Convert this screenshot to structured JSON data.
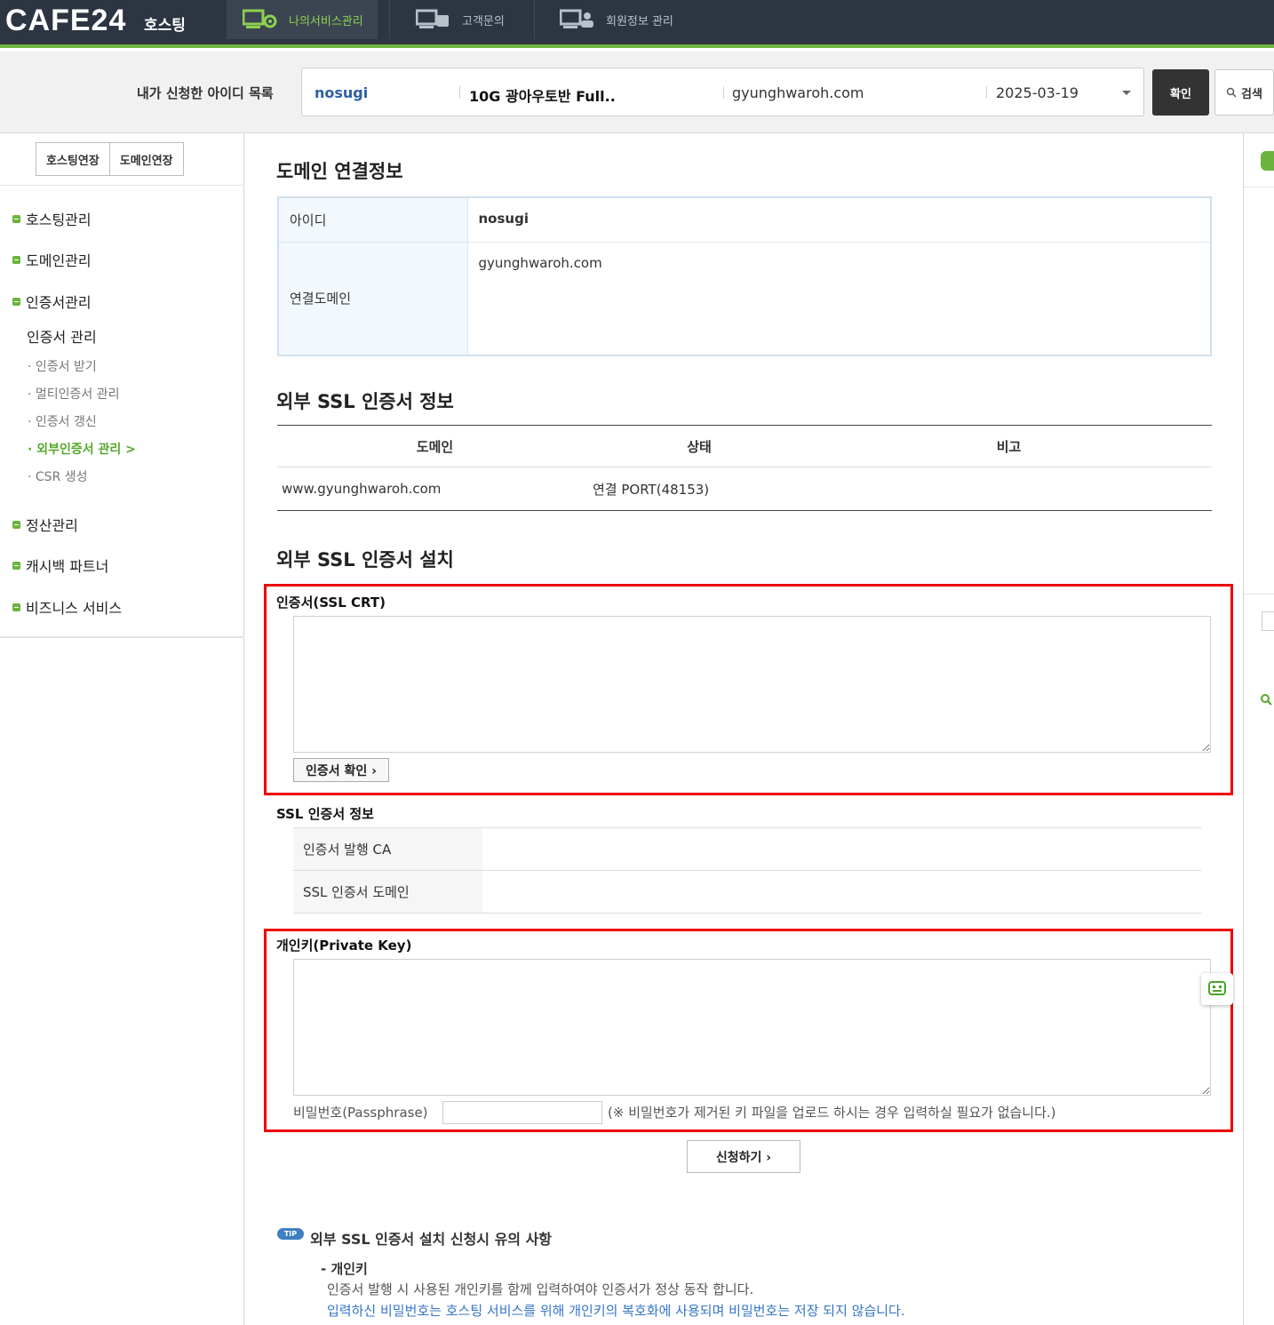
{
  "header": {
    "logo": "CAFE24",
    "logo_sub": "호스팅",
    "tabs": [
      {
        "label": "나의서비스관리"
      },
      {
        "label": "고객문의"
      },
      {
        "label": "회원정보 관리"
      }
    ]
  },
  "idbar": {
    "label": "내가 신청한 아이디 목록",
    "selected": {
      "id": "nosugi",
      "product": "10G 광아우토반 Full..",
      "domain": "gyunghwaroh.com",
      "date": "2025-03-19"
    },
    "confirm": "확인",
    "search": "검색"
  },
  "sidebar": {
    "extend_hosting": "호스팅연장",
    "extend_domain": "도메인연장",
    "menu": [
      {
        "label": "호스팅관리"
      },
      {
        "label": "도메인관리"
      },
      {
        "label": "인증서관리"
      },
      {
        "label": "정산관리"
      },
      {
        "label": "캐시백 파트너"
      },
      {
        "label": "비즈니스 서비스"
      }
    ],
    "sub_title": "인증서 관리",
    "sub_items": [
      {
        "label": "인증서 받기"
      },
      {
        "label": "멀티인증서 관리"
      },
      {
        "label": "인증서 갱신"
      },
      {
        "label": "외부인증서 관리 >"
      },
      {
        "label": "CSR 생성"
      }
    ]
  },
  "domain_info": {
    "title": "도메인 연결정보",
    "id_label": "아이디",
    "id_value": "nosugi",
    "domain_label": "연결도메인",
    "domain_value": "gyunghwaroh.com"
  },
  "ssl_info": {
    "title": "외부 SSL 인증서 정보",
    "columns": [
      "도메인",
      "상태",
      "비고"
    ],
    "rows": [
      {
        "domain": "www.gyunghwaroh.com",
        "status": "연결 PORT(48153)",
        "note": ""
      }
    ]
  },
  "ssl_install": {
    "title": "외부 SSL 인증서 설치",
    "crt_label": "인증서(SSL CRT)",
    "crt_value": "",
    "check_button": "인증서 확인 ›",
    "info_label": "SSL 인증서 정보",
    "ca_label": "인증서 발행 CA",
    "ca_value": "",
    "domain_label": "SSL 인증서 도메인",
    "domain_value": "",
    "key_label": "개인키(Private Key)",
    "key_value": "",
    "pass_label": "비밀번호(Passphrase)",
    "pass_value": "",
    "pass_note": "(※ 비밀번호가 제거된 키 파일을 업로드 하시는 경우 입력하실 필요가 없습니다.)",
    "apply_button": "신청하기 ›"
  },
  "tip": {
    "badge": "TIP",
    "title": "외부 SSL 인증서 설치 신청시 유의 사항",
    "sub": "- 개인키",
    "line1": "인증서 발행 시 사용된 개인키를 함께 입력하여야 인증서가 정상 동작 합니다.",
    "line2": "입력하신 비밀번호는 호스팅 서비스를 위해 개인키의 복호화에 사용되며 비밀번호는 저장 되지 않습니다."
  },
  "colors": {
    "accent_green": "#6fb43f",
    "nav_bg": "#2c3541",
    "highlight_red": "#e00000",
    "link_blue": "#3575c7"
  }
}
